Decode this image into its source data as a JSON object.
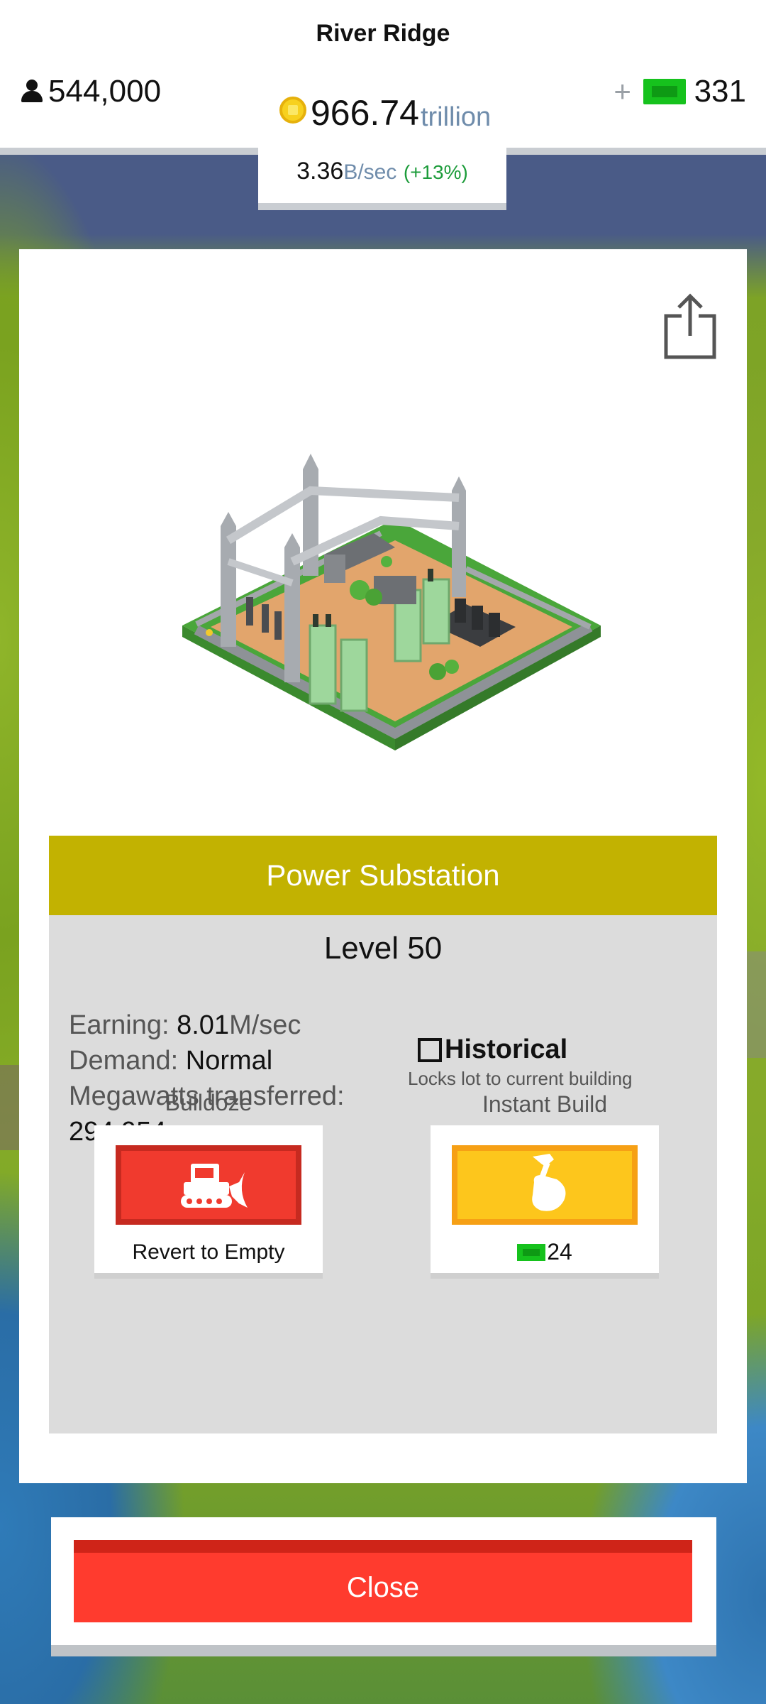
{
  "header": {
    "city_name": "River Ridge",
    "population": "544,000",
    "money_value": "966.74",
    "money_unit": "trillion",
    "rate_value": "3.36",
    "rate_unit": "B/sec",
    "rate_change": "(+13%)",
    "plus_label": "+",
    "cash_count": "331"
  },
  "building": {
    "name": "Power Substation",
    "level": "Level 50",
    "earning_label": "Earning:",
    "earning_value": "8.01",
    "earning_unit": "M/sec",
    "demand_label": "Demand:",
    "demand_value": "Normal",
    "megawatts_label": "Megawatts transferred:",
    "megawatts_value": "294,954",
    "historical_label": "Historical",
    "historical_checked": false,
    "historical_hint": "Locks lot to current building"
  },
  "actions": {
    "bulldoze_label": "Bulldoze",
    "bulldoze_caption": "Revert to Empty",
    "instant_label": "Instant Build",
    "instant_cost": "24"
  },
  "footer": {
    "close_label": "Close"
  },
  "colors": {
    "title_banner": "#c2b201",
    "bulldoze_red": "#f03a2e",
    "instant_yellow": "#fdc61c",
    "close_red": "#ff3b2e",
    "cash_green": "#16c21d"
  },
  "icons": [
    "person-icon",
    "coin-icon",
    "bill-icon",
    "share-icon",
    "bulldozer-icon",
    "hammer-hand-icon"
  ]
}
